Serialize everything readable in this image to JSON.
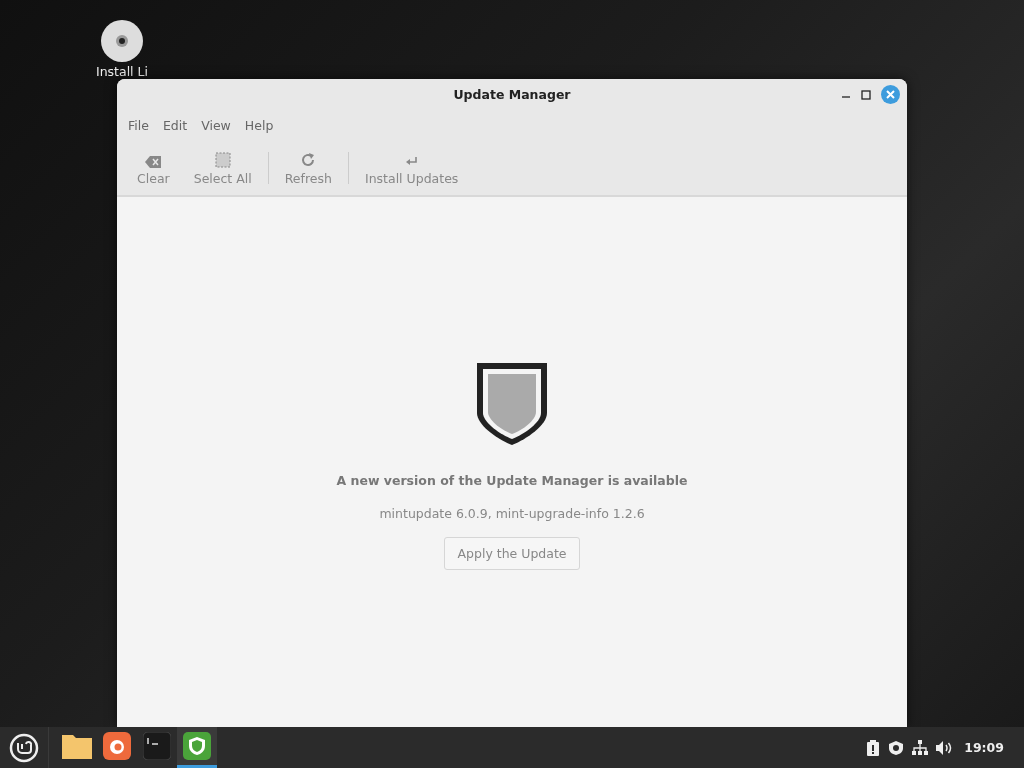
{
  "desktop": {
    "icons": [
      {
        "label": "Install Li"
      }
    ]
  },
  "window": {
    "title": "Update Manager",
    "menu": [
      "File",
      "Edit",
      "View",
      "Help"
    ],
    "toolbar": [
      {
        "kind": "clear",
        "label": "Clear",
        "disabled": true
      },
      {
        "kind": "select",
        "label": "Select All",
        "disabled": true
      },
      {
        "kind": "refresh",
        "label": "Refresh",
        "disabled": true
      },
      {
        "kind": "install",
        "label": "Install Updates",
        "disabled": true
      }
    ],
    "message": {
      "heading": "A new version of the Update Manager is available",
      "detail": "mintupdate 6.0.9, mint-upgrade-info 1.2.6",
      "button": "Apply the Update"
    }
  },
  "taskbar": {
    "launchers": [
      {
        "kind": "files",
        "active": false
      },
      {
        "kind": "browser",
        "active": false
      },
      {
        "kind": "terminal",
        "active": false
      },
      {
        "kind": "update",
        "active": true
      }
    ],
    "clock": "19:09"
  }
}
